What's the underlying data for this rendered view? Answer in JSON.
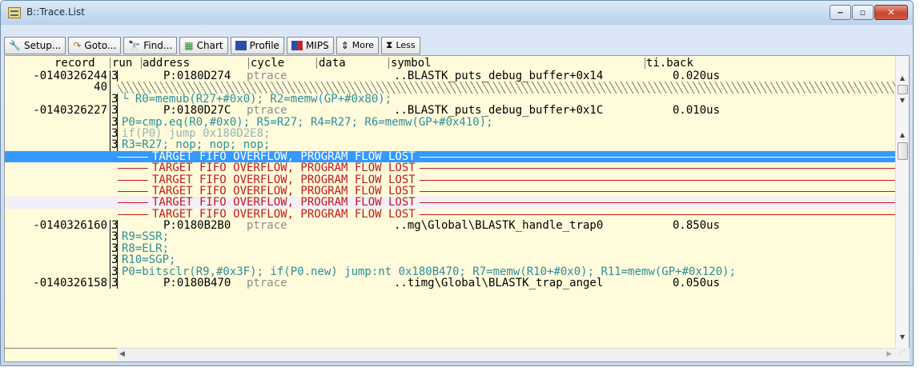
{
  "window": {
    "title": "B::Trace.List",
    "controls": [
      "minimize",
      "maximize",
      "close"
    ]
  },
  "toolbar": {
    "buttons": [
      {
        "label": "Setup...",
        "icon": "wrench-icon",
        "glyph": "🔧"
      },
      {
        "label": "Goto...",
        "icon": "goto-icon",
        "glyph": "↷"
      },
      {
        "label": "Find...",
        "icon": "binoculars-icon",
        "glyph": "🔭"
      },
      {
        "label": "Chart",
        "icon": "chart-icon",
        "glyph": "▦"
      },
      {
        "label": "Profile",
        "icon": "profile-icon",
        "glyph": "▌"
      },
      {
        "label": "MIPS",
        "icon": "mips-icon",
        "glyph": "▌"
      },
      {
        "label": "More",
        "icon": "more-icon",
        "glyph": "⇕"
      },
      {
        "label": "Less",
        "icon": "less-icon",
        "glyph": "⧗"
      }
    ]
  },
  "columns": [
    "record",
    "run",
    "address",
    "cycle",
    "data",
    "symbol",
    "ti.back"
  ],
  "rows": [
    {
      "type": "sym",
      "record": "-0140326244",
      "run": "3",
      "address": "P:0180D274",
      "cycle": "ptrace",
      "symbol": "..BLASTK_puts_debug_buffer+0x14",
      "tiback": "0.020us"
    },
    {
      "type": "hatch",
      "record": "40",
      "run": ""
    },
    {
      "type": "code",
      "record": "",
      "run": "3",
      "text": "└ R0=memub(R27+#0x0); R2=memw(GP+#0x80);",
      "color": "tl"
    },
    {
      "type": "sym",
      "record": "-0140326227",
      "run": "3",
      "address": "P:0180D27C",
      "cycle": "ptrace",
      "symbol": "..BLASTK_puts_debug_buffer+0x1C",
      "tiback": "0.010us"
    },
    {
      "type": "code",
      "record": "",
      "run": "3",
      "text": "P0=cmp.eq(R0,#0x0); R5=R27; R4=R27; R6=memw(GP+#0x410);",
      "color": "tl"
    },
    {
      "type": "code",
      "record": "",
      "run": "3",
      "text": "if(P0) jump 0x180D2E8;",
      "color": "gr"
    },
    {
      "type": "code",
      "record": "",
      "run": "3",
      "text": "R3=R27; nop; nop; nop;",
      "color": "tl"
    },
    {
      "type": "flow",
      "text": "TARGET FIFO OVERFLOW, PROGRAM FLOW LOST",
      "selected": true
    },
    {
      "type": "flow",
      "text": "TARGET FIFO OVERFLOW, PROGRAM FLOW LOST"
    },
    {
      "type": "flow",
      "text": "TARGET FIFO OVERFLOW, PROGRAM FLOW LOST"
    },
    {
      "type": "flow",
      "text": "TARGET FIFO OVERFLOW, PROGRAM FLOW LOST"
    },
    {
      "type": "flow",
      "text": "TARGET FIFO OVERFLOW, PROGRAM FLOW LOST",
      "alt": true
    },
    {
      "type": "flow",
      "text": "TARGET FIFO OVERFLOW, PROGRAM FLOW LOST"
    },
    {
      "type": "sym",
      "record": "-0140326160",
      "run": "3",
      "address": "P:0180B2B0",
      "cycle": "ptrace",
      "symbol": "..mg\\Global\\BLASTK_handle_trap0",
      "tiback": "0.850us"
    },
    {
      "type": "code",
      "record": "",
      "run": "3",
      "text": "R9=SSR;",
      "color": "tl"
    },
    {
      "type": "code",
      "record": "",
      "run": "3",
      "text": "R8=ELR;",
      "color": "tl"
    },
    {
      "type": "code",
      "record": "",
      "run": "3",
      "text": "R10=SGP;",
      "color": "tl"
    },
    {
      "type": "code",
      "record": "",
      "run": "3",
      "text": "P0=bitsclr(R9,#0x3F); if(P0.new) jump:nt 0x180B470; R7=memw(R10+#0x0); R11=memw(GP+#0x120);",
      "color": "tl"
    },
    {
      "type": "sym",
      "record": "-0140326158",
      "run": "3",
      "address": "P:0180B470",
      "cycle": "ptrace",
      "symbol": "..timg\\Global\\BLASTK_trap_angel",
      "tiback": "0.050us"
    }
  ],
  "colors": {
    "accent": "#3399ff",
    "background": "#fffbdb",
    "overflow": "#c11a1a",
    "code": "#2d8e9b",
    "pointer": "#ff0000"
  }
}
